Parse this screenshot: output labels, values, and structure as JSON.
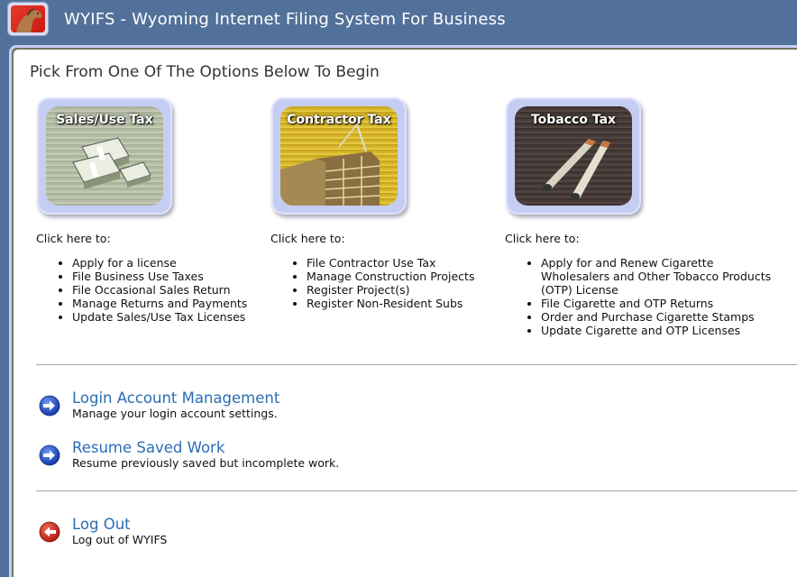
{
  "header": {
    "logo": "horse-logo",
    "title": "WYIFS - Wyoming Internet Filing System For Business"
  },
  "main": {
    "page_title": "Pick From One Of The Options Below To Begin",
    "tiles": [
      {
        "label": "Sales/Use Tax",
        "image": "money-stacks-image",
        "lead": "Click here to:",
        "items": [
          "Apply for a license",
          "File Business Use Taxes",
          "File Occasional Sales Return",
          "Manage Returns and Payments",
          "Update Sales/Use Tax Licenses"
        ]
      },
      {
        "label": "Contractor Tax",
        "image": "construction-building-image",
        "lead": "Click here to:",
        "items": [
          "File Contractor Use Tax",
          "Manage Construction Projects",
          "Register Project(s)",
          "Register Non-Resident Subs"
        ]
      },
      {
        "label": "Tobacco Tax",
        "image": "cigarettes-image",
        "lead": "Click here to:",
        "items": [
          "Apply for and Renew Cigarette Wholesalers and Other Tobacco Products (OTP) License",
          "File Cigarette and OTP Returns",
          "Order and Purchase Cigarette Stamps",
          "Update Cigarette and OTP Licenses"
        ]
      }
    ],
    "actions": [
      {
        "icon": "arrow-right-circle-icon",
        "title": "Login Account Management",
        "desc": "Manage your login account settings."
      },
      {
        "icon": "arrow-right-circle-icon",
        "title": "Resume Saved Work",
        "desc": "Resume previously saved but incomplete work."
      },
      {
        "icon": "arrow-left-circle-icon",
        "title": "Log Out",
        "desc": "Log out of WYIFS"
      }
    ]
  },
  "colors": {
    "header_bg": "#52719a",
    "link": "#2a6db5",
    "tile_frame": "#c6cdf3",
    "nav_blue": "#1f50c8",
    "logout_red": "#d42a1e"
  }
}
